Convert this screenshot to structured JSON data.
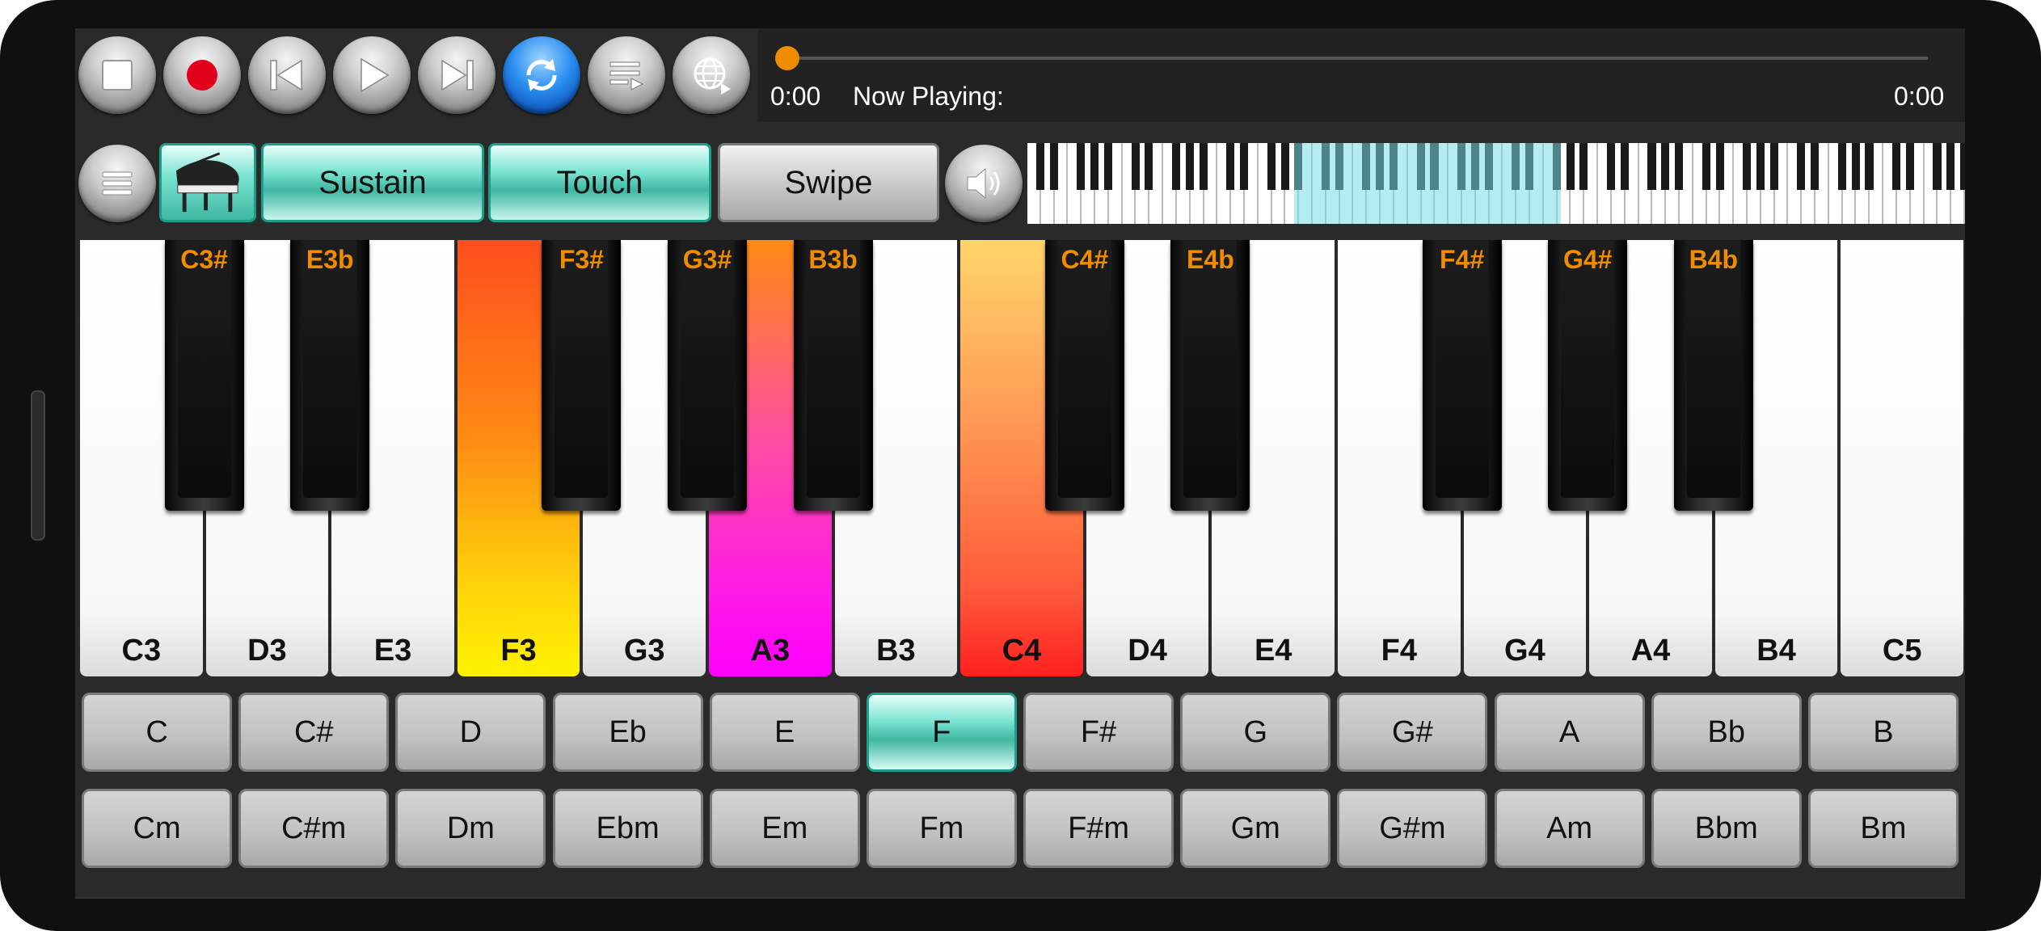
{
  "transport": {
    "elapsed": "0:00",
    "now_playing_label": "Now Playing:",
    "duration": "0:00",
    "progress": 0,
    "buttons": [
      "stop-icon",
      "record-icon",
      "skip-back-icon",
      "play-icon",
      "skip-forward-icon",
      "loop-icon",
      "playlist-icon",
      "web-icon"
    ]
  },
  "toolbar": {
    "menu_icon": "menu-icon",
    "instrument_icon": "grand-piano-icon",
    "sustain_label": "Sustain",
    "touch_label": "Touch",
    "swipe_label": "Swipe",
    "volume_icon": "speaker-icon",
    "sustain_on": true,
    "touch_on": true,
    "swipe_on": false
  },
  "keyboard": {
    "white_keys": [
      "C3",
      "D3",
      "E3",
      "F3",
      "G3",
      "A3",
      "B3",
      "C4",
      "D4",
      "E4",
      "F4",
      "G4",
      "A4",
      "B4",
      "C5"
    ],
    "black_keys": [
      "C3#",
      "E3b",
      "F3#",
      "G3#",
      "B3b",
      "C4#",
      "E4b",
      "F4#",
      "G4#",
      "B4b"
    ],
    "pressed_keys": [
      "F3",
      "A3",
      "C4"
    ]
  },
  "chords": {
    "major": [
      "C",
      "C#",
      "D",
      "Eb",
      "E",
      "F",
      "F#",
      "G",
      "G#",
      "A",
      "Bb",
      "B"
    ],
    "minor": [
      "Cm",
      "C#m",
      "Dm",
      "Ebm",
      "Em",
      "Fm",
      "F#m",
      "Gm",
      "G#m",
      "Am",
      "Bbm",
      "Bm"
    ],
    "selected": "F"
  },
  "colors": {
    "accent_teal": "#3fb7a3",
    "progress_orange": "#f08c00",
    "black_key_label": "#f08c00"
  }
}
